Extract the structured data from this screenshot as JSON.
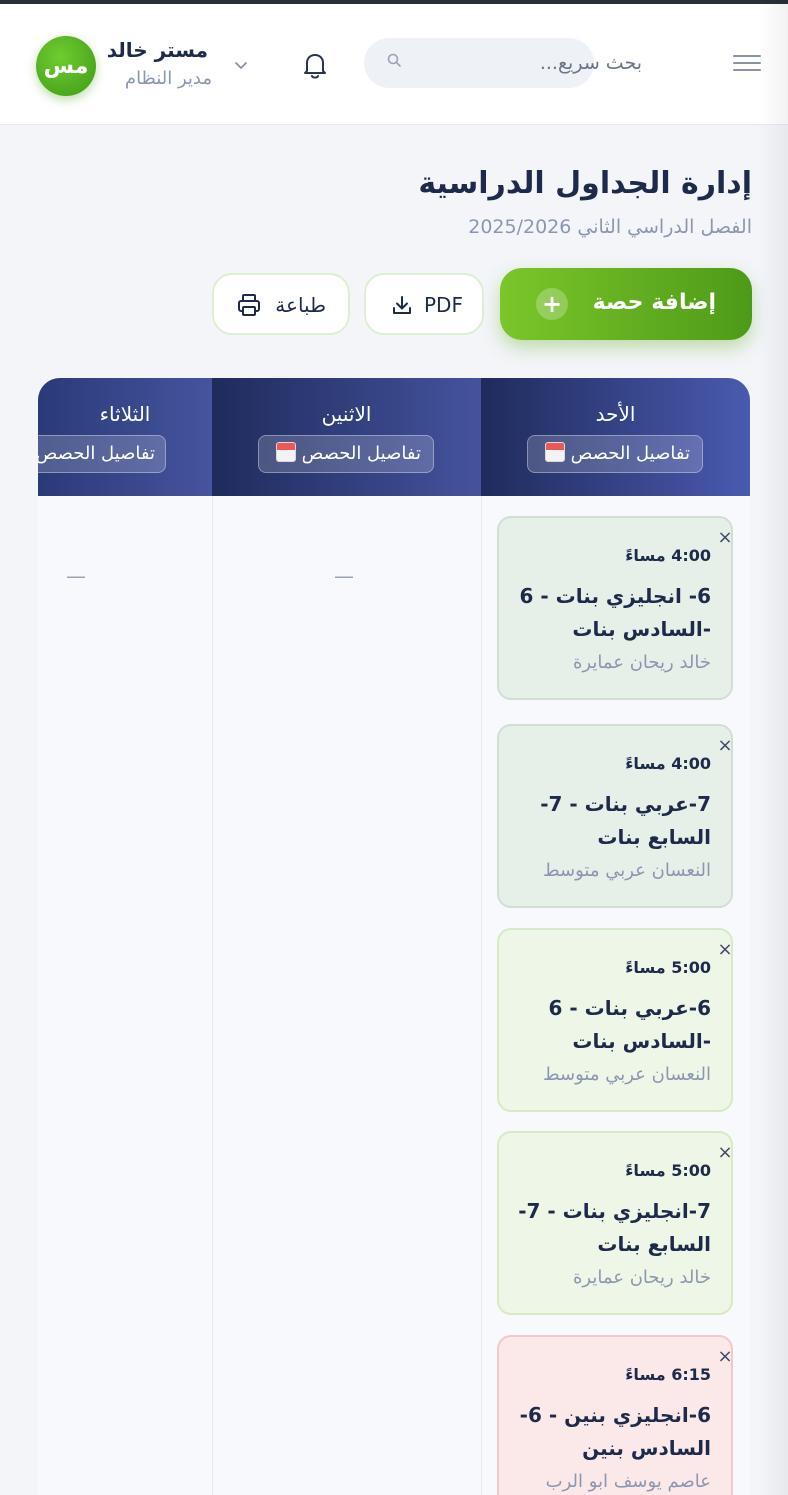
{
  "header": {
    "search_placeholder": "بحث سريع...",
    "user_name": "مستر خالد",
    "user_role": "مدير النظام",
    "avatar_initials": "مس"
  },
  "page": {
    "title": "إدارة الجداول الدراسية",
    "subtitle": "الفصل الدراسي الثاني 2025/2026"
  },
  "actions": {
    "add_label": "إضافة حصة",
    "pdf_label": "PDF",
    "print_label": "طباعة"
  },
  "days": [
    {
      "name": "الأحد",
      "details_label": "تفاصيل الحصص"
    },
    {
      "name": "الاثنين",
      "details_label": "تفاصيل الحصص"
    },
    {
      "name": "الثلاثاء",
      "details_label": "تفاصيل الحصص"
    }
  ],
  "empty_marker": "—",
  "sessions": [
    {
      "time": "4:00 مساءً",
      "subject": "6- انجليزي بنات - 6 -السادس بنات",
      "teacher": "خالد ريحان عمايرة",
      "tone": "gray"
    },
    {
      "time": "4:00 مساءً",
      "subject": "7-عربي بنات - 7- السابع بنات",
      "teacher": "النعسان عربي متوسط",
      "tone": "gray"
    },
    {
      "time": "5:00 مساءً",
      "subject": "6-عربي بنات - 6 -السادس بنات",
      "teacher": "النعسان عربي متوسط",
      "tone": "green"
    },
    {
      "time": "5:00 مساءً",
      "subject": "7-انجليزي بنات - 7- السابع بنات",
      "teacher": "خالد ريحان عمايرة",
      "tone": "green"
    },
    {
      "time": "6:15 مساءً",
      "subject": "6-انجليزي بنين - 6- السادس بنين",
      "teacher": "عاصم يوسف ابو الرب",
      "tone": "red"
    }
  ],
  "colors": {
    "accent_green": "#5fae1e",
    "header_navy": "#1f2b5c",
    "text_dark": "#1d2a4a",
    "text_muted": "#8b97b0"
  },
  "icons": [
    "menu-icon",
    "search-icon",
    "bell-icon",
    "chevron-down-icon",
    "plus-icon",
    "download-icon",
    "printer-icon",
    "calendar-icon",
    "close-icon"
  ]
}
